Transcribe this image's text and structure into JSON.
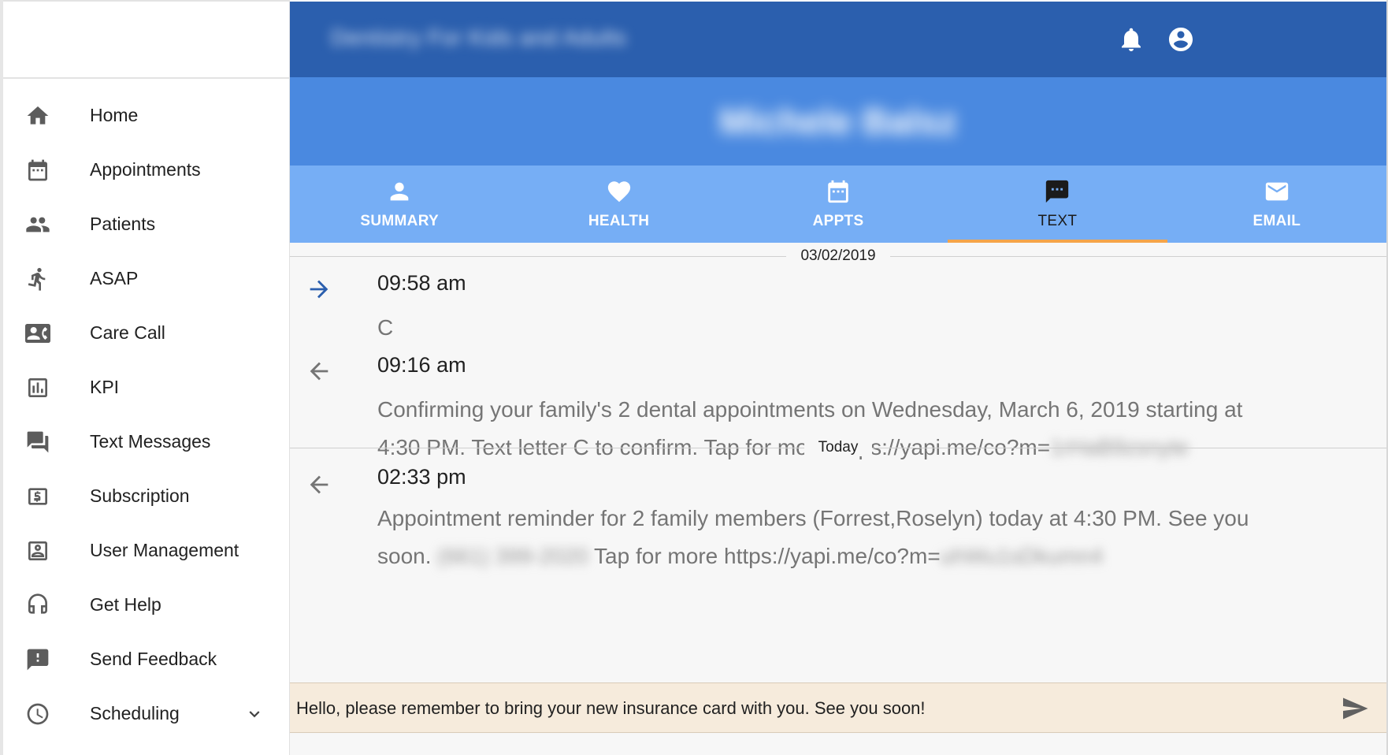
{
  "header": {
    "practice_name": "Dentistry For Kids and Adults",
    "patient_name": "Michele Balsz",
    "icons": [
      "bell-icon",
      "account-circle-icon"
    ]
  },
  "sidebar": {
    "items": [
      {
        "label": "Home",
        "icon": "home-icon"
      },
      {
        "label": "Appointments",
        "icon": "calendar-icon"
      },
      {
        "label": "Patients",
        "icon": "people-icon"
      },
      {
        "label": "ASAP",
        "icon": "running-person-icon"
      },
      {
        "label": "Care Call",
        "icon": "contact-phone-icon"
      },
      {
        "label": "KPI",
        "icon": "bar-chart-icon"
      },
      {
        "label": "Text Messages",
        "icon": "chat-bubbles-icon"
      },
      {
        "label": "Subscription",
        "icon": "dollar-card-icon"
      },
      {
        "label": "User Management",
        "icon": "user-box-icon"
      },
      {
        "label": "Get Help",
        "icon": "headset-icon"
      },
      {
        "label": "Send Feedback",
        "icon": "feedback-icon"
      },
      {
        "label": "Scheduling",
        "icon": "clock-icon",
        "expandable": true
      }
    ]
  },
  "tabs": [
    {
      "label": "SUMMARY",
      "icon": "person-icon",
      "active": false
    },
    {
      "label": "HEALTH",
      "icon": "heart-icon",
      "active": false
    },
    {
      "label": "APPTS",
      "icon": "calendar-icon",
      "active": false
    },
    {
      "label": "TEXT",
      "icon": "message-icon",
      "active": true
    },
    {
      "label": "EMAIL",
      "icon": "mail-icon",
      "active": false
    }
  ],
  "thread": {
    "separators": [
      "03/02/2019",
      "Today"
    ],
    "messages": [
      {
        "direction": "outgoing",
        "time": "09:58 am",
        "body": "C"
      },
      {
        "direction": "incoming",
        "time": "09:16 am",
        "body_line1": "Confirming your family's 2 dental appointments on Wednesday, March 6, 2019 starting at",
        "body_line2": "4:30 PM. Text letter C to confirm. Tap for more https://yapi.me/co?m=",
        "body_hidden": "1rHaB9zsnyte"
      },
      {
        "direction": "incoming",
        "time": "02:33 pm",
        "body_line1": "Appointment reminder for 2 family members (Forrest,Roselyn) today at 4:30 PM. See you",
        "body_line2_prefix": "soon.",
        "body_hidden_phone": "(661) 399-2020",
        "body_line2_mid": "Tap for more https://yapi.me/co?m=",
        "body_hidden_code": "uhWu1sDkumn4"
      }
    ]
  },
  "composer": {
    "value": "Hello, please remember to bring your new insurance card with you. See you soon!",
    "send_icon": "send-icon"
  },
  "colors": {
    "topbar": "#2b5fae",
    "banner": "#4a89e0",
    "tabs": "#76aef5",
    "active_tab_underline": "#f5a54a",
    "composer_bg": "#f6ebdc",
    "outgoing_arrow": "#2b5fae"
  }
}
